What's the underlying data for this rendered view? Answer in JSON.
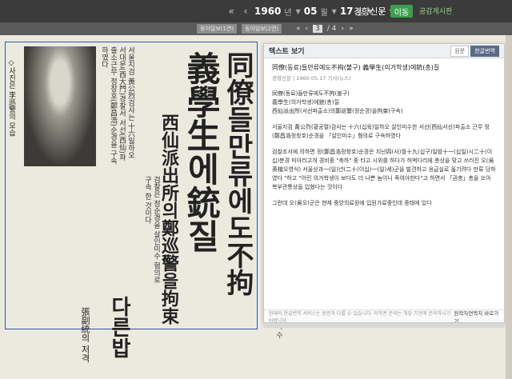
{
  "toolbar": {
    "year": "1960",
    "year_unit": "년",
    "month": "05",
    "month_unit": "월",
    "day": "17",
    "day_unit": "일",
    "newspaper": "경향신문",
    "go_label": "이동",
    "public_link": "공감게시판"
  },
  "subbar": {
    "page_btn_prev": "동아일보(1면)",
    "page_btn_next": "동아일보(2면)",
    "current_page": "3",
    "total_pages": "/ 4"
  },
  "newspaper": {
    "caption": "◇사진은 李巡警의 모습",
    "col1": "서울지검 黃公烈검사는 十六일하오 서대문(西大門)경찰서 서선(西仙)파출소근무 정창호(鄭昌浩)순경을 구속하였다",
    "col2": "검찰은 정순경을 살인미수 혐의로 구속 한 것이다",
    "headline1": "同僚들만류에도不拘",
    "headline2": "義學生에銃질",
    "headline3": "西仙派出所의鄭巡警을拘束",
    "headline4": "다른밥",
    "headline5": "張副統의 저격",
    "margin": "(右) 가 수"
  },
  "panel": {
    "title": "텍스트 보기",
    "toggle_orig": "원문",
    "toggle_modern": "한글번역",
    "article_title_a": "同僚(동료)들만류에도不拘(불구) 義學生(의거학생)에銃(총)질",
    "meta": "경향신문 | 1960.05.17 기사(뉴스)",
    "line1": "同僚(동료)들만류에도不拘(불구)",
    "line2": "義學生(의거학생)에銃(총)질",
    "line3": "西仙派出所(서선파출소)의鄭巡警(정순경)을拘束(구속)",
    "para1": "서울지검 黃公烈(황공렬)검사는 十六(십육)일하오 살인미수한 서선(西仙서선)파출소 근무 정(鄭昌浩정창호)순경을 「살인미수」혐의로 구속하였다",
    "para2": "검찰조서에 의하면 정(鄭昌浩정창호)순경은 지난四(사)월十九(십구)일밤十一(십일)시二十(이십)분경 미아리고개 경비중 \"축하\" 중 타고 시위를 하다가 허벅다리에 총상을 맞고 쓰러진 오(吳英植오영식) 서울상과一(일)년(二十(이십)一(일)세)군을 발견하고 응급실로 옮기려다 만류 당하였다 \"하고 \"어린 의거학생이 보다도 더 나쁜 놈이니 죽여야한다\"고 하면서 「권총」총을 쏘아 복부관통상을 입혔다는 것이다",
    "para3": "그런데 오(吳오)군은 현재 중앙의료원에 입원가료중인데 중태에 있다",
    "foot_left": "현재의 한글번역 서비스는 원문과 다를 수 있습니다. 저작권 문의는 해당 기관에 문의하시기 바랍니다.",
    "foot_right": "원작자연락처 바로가기"
  }
}
